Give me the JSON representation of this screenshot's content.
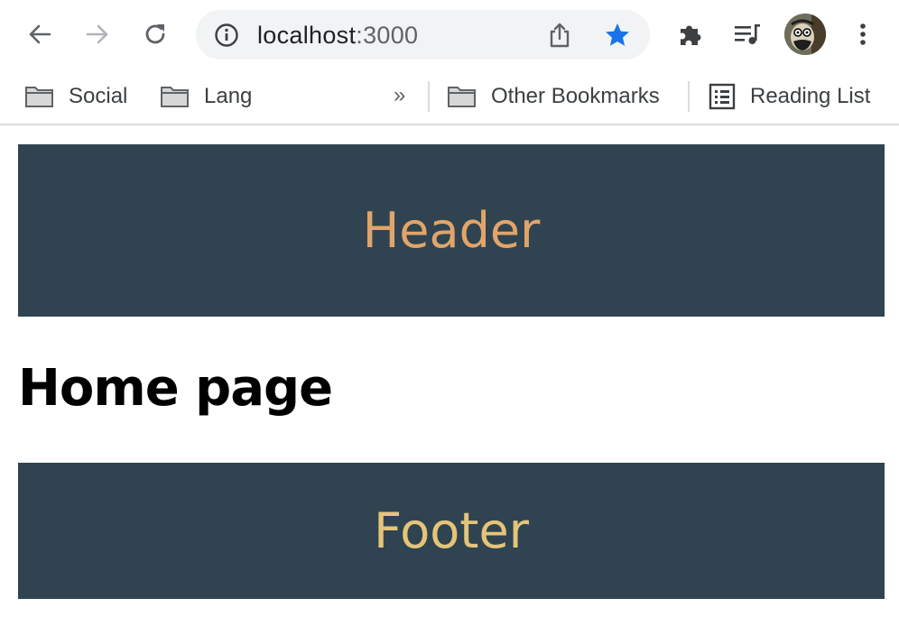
{
  "browser": {
    "url_host": "localhost",
    "url_port": ":3000",
    "icons": {
      "back": "arrow-left-icon",
      "forward": "arrow-right-icon",
      "reload": "reload-icon",
      "site_info": "info-icon",
      "share": "share-icon",
      "bookmark": "star-icon",
      "extensions": "puzzle-icon",
      "media": "media-queue-icon",
      "menu": "kebab-menu-icon"
    },
    "bookmark_star_color": "#1a73e8"
  },
  "bookmarks": {
    "items": [
      {
        "label": "Social",
        "icon": "folder-icon"
      },
      {
        "label": "Lang",
        "icon": "folder-icon"
      }
    ],
    "more_label": "»",
    "other_label": "Other Bookmarks",
    "reading_list_label": "Reading List"
  },
  "page": {
    "header_text": "Header",
    "title": "Home page",
    "footer_text": "Footer",
    "colors": {
      "block_bg": "#2f4450",
      "header_text": "#e2a46a",
      "footer_text": "#e5c47a"
    }
  }
}
